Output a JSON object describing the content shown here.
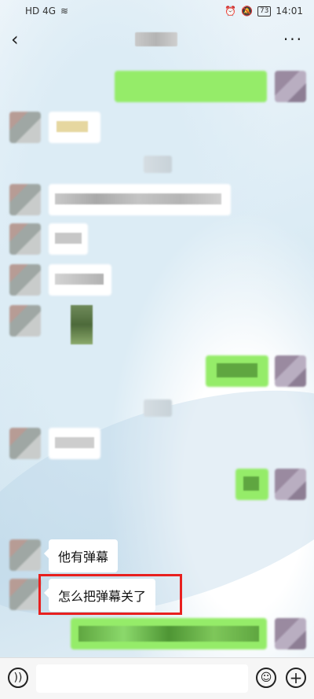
{
  "status_bar": {
    "left_signal": "HD 4G",
    "battery": "73",
    "time": "14:01"
  },
  "header": {
    "back_icon": "chevron-left-icon",
    "more_icon": "more-horizontal-icon"
  },
  "messages": {
    "visible": [
      "他有弹幕",
      "怎么把弹幕关了"
    ]
  },
  "input_bar": {
    "voice_icon": "voice-icon",
    "emoji_icon": "emoji-icon",
    "plus_icon": "plus-icon",
    "placeholder": ""
  },
  "colors": {
    "highlight": "#e8201f",
    "sent_bubble": "#95ec69",
    "received_bubble": "#ffffff"
  }
}
